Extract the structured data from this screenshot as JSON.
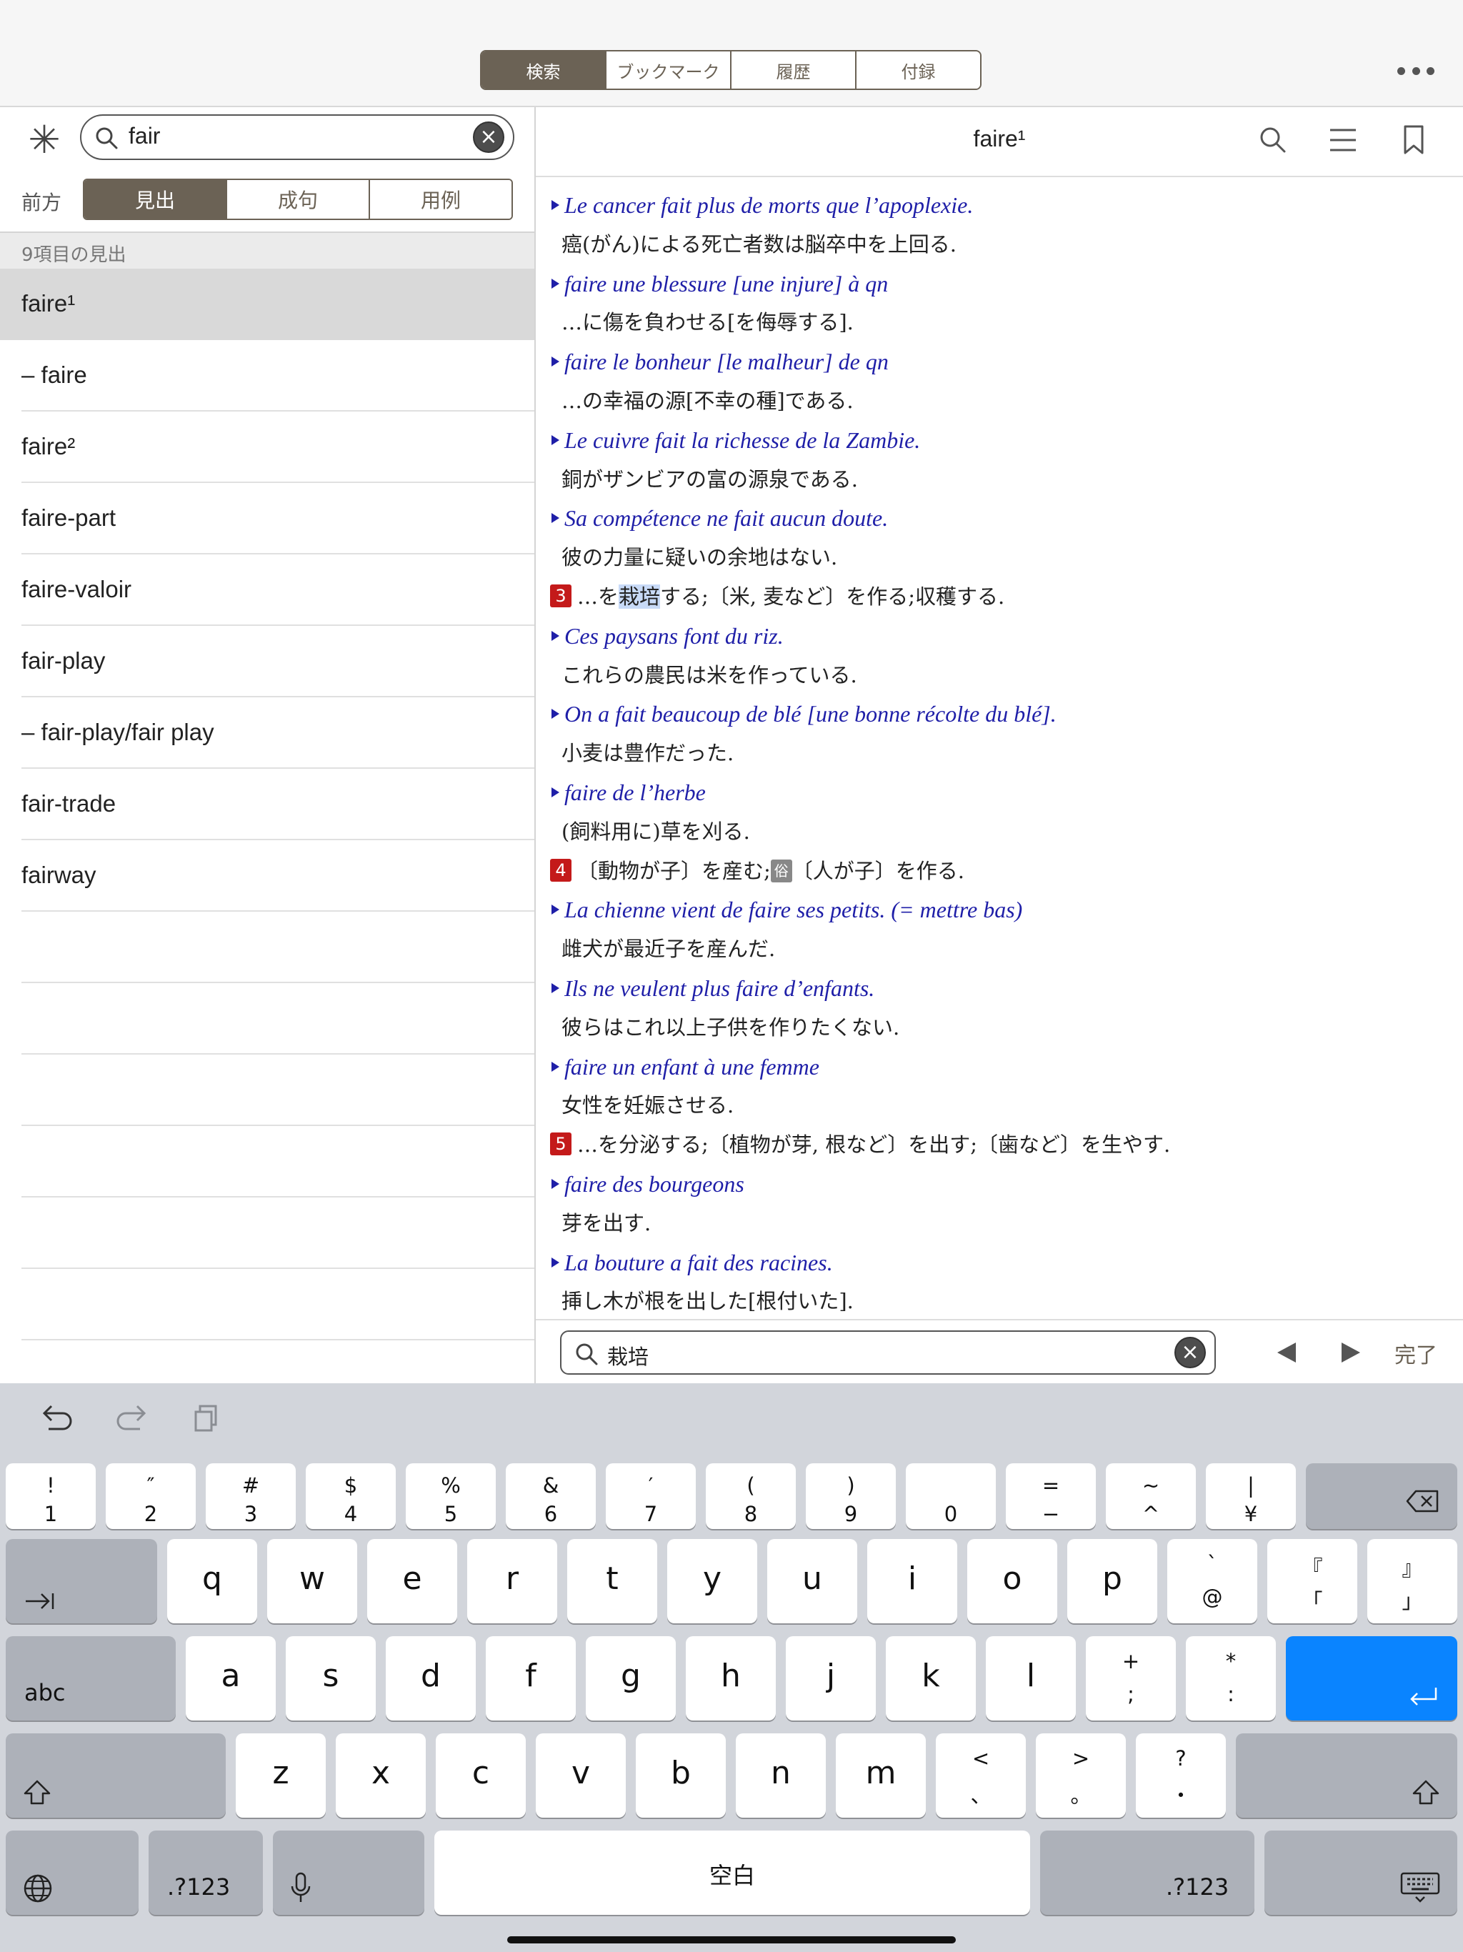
{
  "top_tabs": [
    {
      "label": "検索",
      "active": true
    },
    {
      "label": "ブックマーク",
      "active": false
    },
    {
      "label": "履歴",
      "active": false
    },
    {
      "label": "付録",
      "active": false
    }
  ],
  "left": {
    "search_value": "fair",
    "direction_label": "前方",
    "mode_tabs": [
      {
        "label": "見出",
        "active": true
      },
      {
        "label": "成句",
        "active": false
      },
      {
        "label": "用例",
        "active": false
      }
    ],
    "result_count": "9項目の見出",
    "results": [
      "faire¹",
      "– faire",
      "faire²",
      "faire-part",
      "faire-valoir",
      "fair-play",
      "– fair-play/fair play",
      "fair-trade",
      "fairway"
    ],
    "selected_index": 0
  },
  "right": {
    "title": "faire¹",
    "entries": [
      {
        "kind": "fr",
        "text": "Le cancer fait plus de morts que l’apoplexie."
      },
      {
        "kind": "jp",
        "text": "癌(がん)による死亡者数は脳卒中を上回る."
      },
      {
        "kind": "fr",
        "text": "faire une blessure [une injure] à qn"
      },
      {
        "kind": "jp",
        "text": "…に傷を負わせる[を侮辱する]."
      },
      {
        "kind": "fr",
        "text": "faire le bonheur [le malheur] de qn"
      },
      {
        "kind": "jp",
        "text": "…の幸福の源[不幸の種]である."
      },
      {
        "kind": "fr",
        "text": "Le cuivre fait la richesse de la Zambie."
      },
      {
        "kind": "jp",
        "text": "銅がザンビアの富の源泉である."
      },
      {
        "kind": "fr",
        "text": "Sa compétence ne fait aucun doute."
      },
      {
        "kind": "jp",
        "text": "彼の力量に疑いの余地はない."
      },
      {
        "kind": "sense",
        "num": "3",
        "pre": "…を",
        "hl": "栽培",
        "post": "する;〔米, 麦など〕を作る;収穫する."
      },
      {
        "kind": "fr",
        "text": "Ces paysans font du riz."
      },
      {
        "kind": "jp",
        "text": "これらの農民は米を作っている."
      },
      {
        "kind": "fr",
        "text": "On a fait beaucoup de blé [une bonne récolte du blé]."
      },
      {
        "kind": "jp",
        "text": "小麦は豊作だった."
      },
      {
        "kind": "fr",
        "text": "faire de l’herbe"
      },
      {
        "kind": "jp",
        "text": "(飼料用に)草を刈る."
      },
      {
        "kind": "sense4",
        "num": "4",
        "pre": "〔動物が子〕を産む;",
        "tag": "俗",
        "post": "〔人が子〕を作る."
      },
      {
        "kind": "fr",
        "text": "La chienne vient de faire ses petits. (= mettre bas)"
      },
      {
        "kind": "jp",
        "text": "雌犬が最近子を産んだ."
      },
      {
        "kind": "fr",
        "text": "Ils ne veulent plus faire d’enfants."
      },
      {
        "kind": "jp",
        "text": "彼らはこれ以上子供を作りたくない."
      },
      {
        "kind": "fr",
        "text": "faire un enfant à une femme"
      },
      {
        "kind": "jp",
        "text": "女性を妊娠させる."
      },
      {
        "kind": "sense",
        "num": "5",
        "pre": "…を分泌する;〔植物が芽, 根など〕を出す;〔歯など〕を生やす.",
        "hl": "",
        "post": ""
      },
      {
        "kind": "fr",
        "text": "faire des bourgeons"
      },
      {
        "kind": "jp",
        "text": "芽を出す."
      },
      {
        "kind": "fr",
        "text": "La bouture a fait des racines."
      },
      {
        "kind": "jp",
        "text": "挿し木が根を出した[根付いた]."
      }
    ],
    "find_value": "栽培",
    "done_label": "完了"
  },
  "keyboard": {
    "row1": [
      {
        "top": "!",
        "bottom": "1"
      },
      {
        "top": "″",
        "bottom": "2"
      },
      {
        "top": "#",
        "bottom": "3"
      },
      {
        "top": "$",
        "bottom": "4"
      },
      {
        "top": "%",
        "bottom": "5"
      },
      {
        "top": "&",
        "bottom": "6"
      },
      {
        "top": "′",
        "bottom": "7"
      },
      {
        "top": "(",
        "bottom": "8"
      },
      {
        "top": ")",
        "bottom": "9"
      },
      {
        "top": "",
        "bottom": "0"
      },
      {
        "top": "=",
        "bottom": "−"
      },
      {
        "top": "~",
        "bottom": "^"
      },
      {
        "top": "|",
        "bottom": "¥"
      }
    ],
    "row2": [
      "q",
      "w",
      "e",
      "r",
      "t",
      "y",
      "u",
      "i",
      "o",
      "p"
    ],
    "row2_extra": [
      {
        "top": "`",
        "bottom": "@"
      },
      {
        "top": "『",
        "bottom": "「"
      },
      {
        "top": "』",
        "bottom": "」"
      }
    ],
    "row3": [
      "a",
      "s",
      "d",
      "f",
      "g",
      "h",
      "j",
      "k",
      "l"
    ],
    "row3_extra": [
      {
        "top": "+",
        "bottom": ";"
      },
      {
        "top": "*",
        "bottom": ":"
      }
    ],
    "abc_label": "abc",
    "row4": [
      "z",
      "x",
      "c",
      "v",
      "b",
      "n",
      "m"
    ],
    "row4_extra": [
      {
        "top": "<",
        "bottom": "、"
      },
      {
        "top": ">",
        "bottom": "。"
      },
      {
        "top": "?",
        "bottom": "・"
      }
    ],
    "numbers_label": ".?123",
    "space_label": "空白",
    "accent_color": "#0a84ff"
  }
}
